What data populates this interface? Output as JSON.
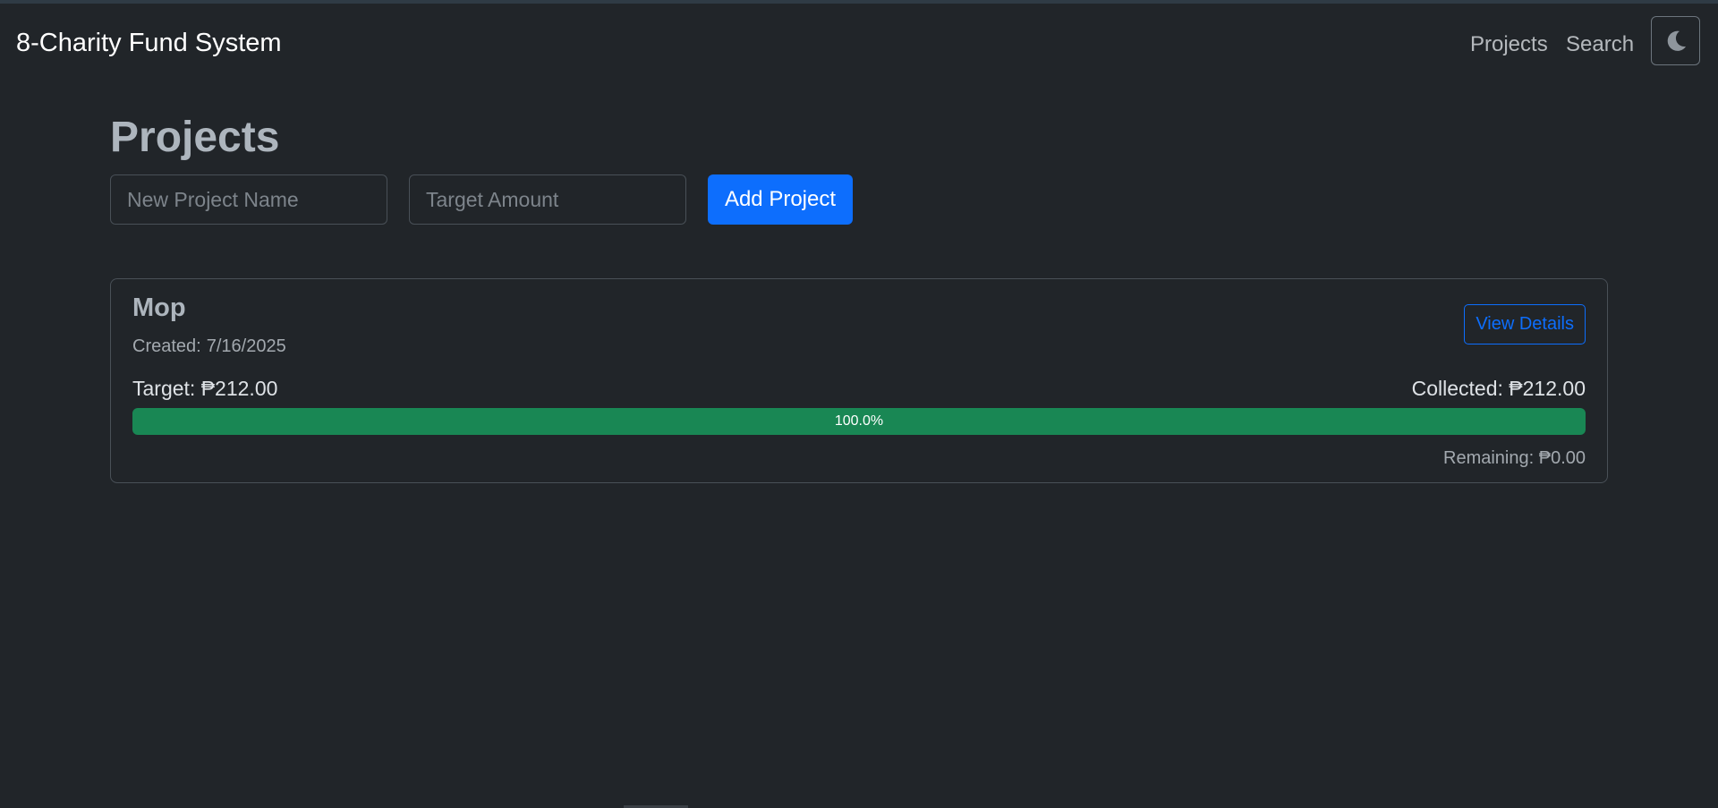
{
  "navbar": {
    "brand": "8-Charity Fund System",
    "links": [
      "Projects",
      "Search"
    ],
    "theme_toggle_icon": "moon-icon"
  },
  "main": {
    "title": "Projects",
    "new_project_name_placeholder": "New Project Name",
    "target_amount_placeholder": "Target Amount",
    "add_button_label": "Add Project"
  },
  "projects": [
    {
      "name": "Mop",
      "created_label": "Created:",
      "created_date": "7/16/2025",
      "view_details_label": "View Details",
      "target_label": "Target:",
      "target": "₱212.00",
      "collected_label": "Collected:",
      "collected": "₱212.00",
      "progress_percent": 100.0,
      "progress_label": "100.0%",
      "remaining_label": "Remaining:",
      "remaining": "₱0.00"
    }
  ],
  "colors": {
    "background": "#212529",
    "primary": "#0d6efd",
    "success": "#198754",
    "border": "#495057"
  }
}
